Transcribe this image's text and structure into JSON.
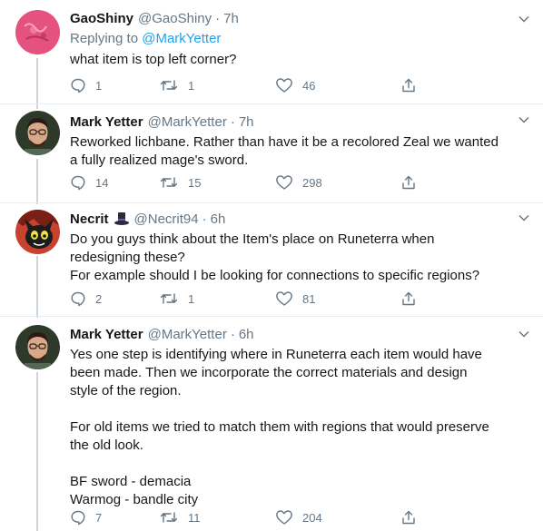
{
  "tweets": [
    {
      "name": "GaoShiny",
      "handle": "@GaoShiny",
      "dot": "·",
      "time": "7h",
      "reply_prefix": "Replying to",
      "reply_mention": "@MarkYetter",
      "lines": [
        "what item is top left corner?"
      ],
      "counts": {
        "replies": "1",
        "retweets": "1",
        "likes": "46"
      }
    },
    {
      "name": "Mark Yetter",
      "handle": "@MarkYetter",
      "dot": "·",
      "time": "7h",
      "lines": [
        "Reworked lichbane. Rather than have it be a recolored Zeal we wanted",
        "a fully realized mage's sword."
      ],
      "counts": {
        "replies": "14",
        "retweets": "15",
        "likes": "298"
      }
    },
    {
      "name": "Necrit",
      "handle": "@Necrit94",
      "dot": "·",
      "time": "6h",
      "lines": [
        "Do you guys think about the Item's place on Runeterra when",
        "redesigning these?",
        "For example should I be looking for connections to specific regions?"
      ],
      "counts": {
        "replies": "2",
        "retweets": "1",
        "likes": "81"
      }
    },
    {
      "name": "Mark Yetter",
      "handle": "@MarkYetter",
      "dot": "·",
      "time": "6h",
      "lines": [
        "Yes one step is identifying where in Runeterra each item would have",
        "been made. Then we incorporate the correct materials and design",
        "style of the region.",
        "",
        "For old items we tried to match them with regions that would preserve",
        "the old look.",
        "",
        "BF sword - demacia",
        "Warmog - bandle city"
      ],
      "counts": {
        "replies": "7",
        "retweets": "11",
        "likes": "204"
      }
    }
  ],
  "colors": {
    "text": "#14171a",
    "secondary": "#657786",
    "link": "#1da1f2",
    "thread_line": "#ccd6dd"
  }
}
